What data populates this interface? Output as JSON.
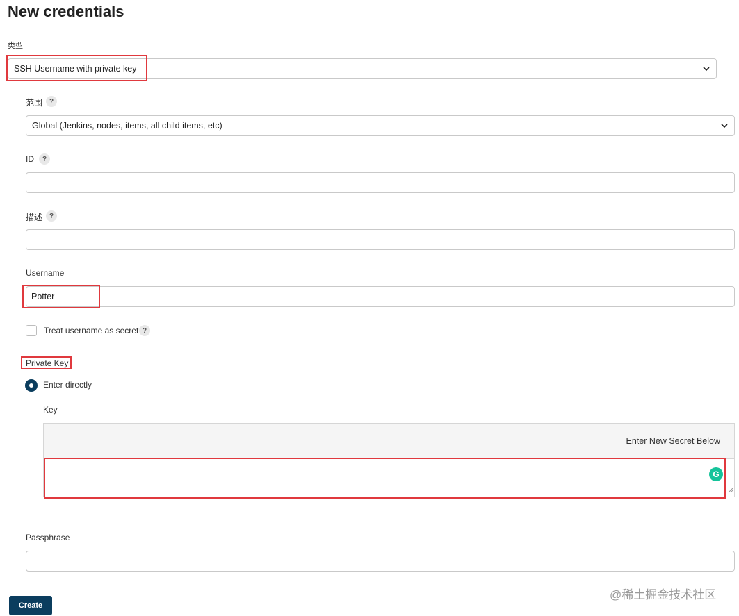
{
  "page": {
    "title": "New credentials"
  },
  "kind": {
    "label": "类型",
    "value": "SSH Username with private key"
  },
  "scope": {
    "label": "范围",
    "value": "Global (Jenkins, nodes, items, all child items, etc)"
  },
  "id_field": {
    "label": "ID",
    "value": ""
  },
  "description": {
    "label": "描述",
    "value": ""
  },
  "username": {
    "label": "Username",
    "value": "Potter"
  },
  "treat_secret": {
    "label": "Treat username as secret",
    "checked": false
  },
  "private_key": {
    "label": "Private Key",
    "option_label": "Enter directly",
    "key_label": "Key",
    "secret_header": "Enter New Secret Below",
    "value": ""
  },
  "passphrase": {
    "label": "Passphrase",
    "value": ""
  },
  "help_glyph": "?",
  "grammarly_glyph": "G",
  "actions": {
    "create_label": "Create"
  },
  "watermark": "@稀土掘金技术社区",
  "colors": {
    "primary": "#0b3d5e",
    "highlight": "#e0393e",
    "grammarly": "#15c39a"
  }
}
